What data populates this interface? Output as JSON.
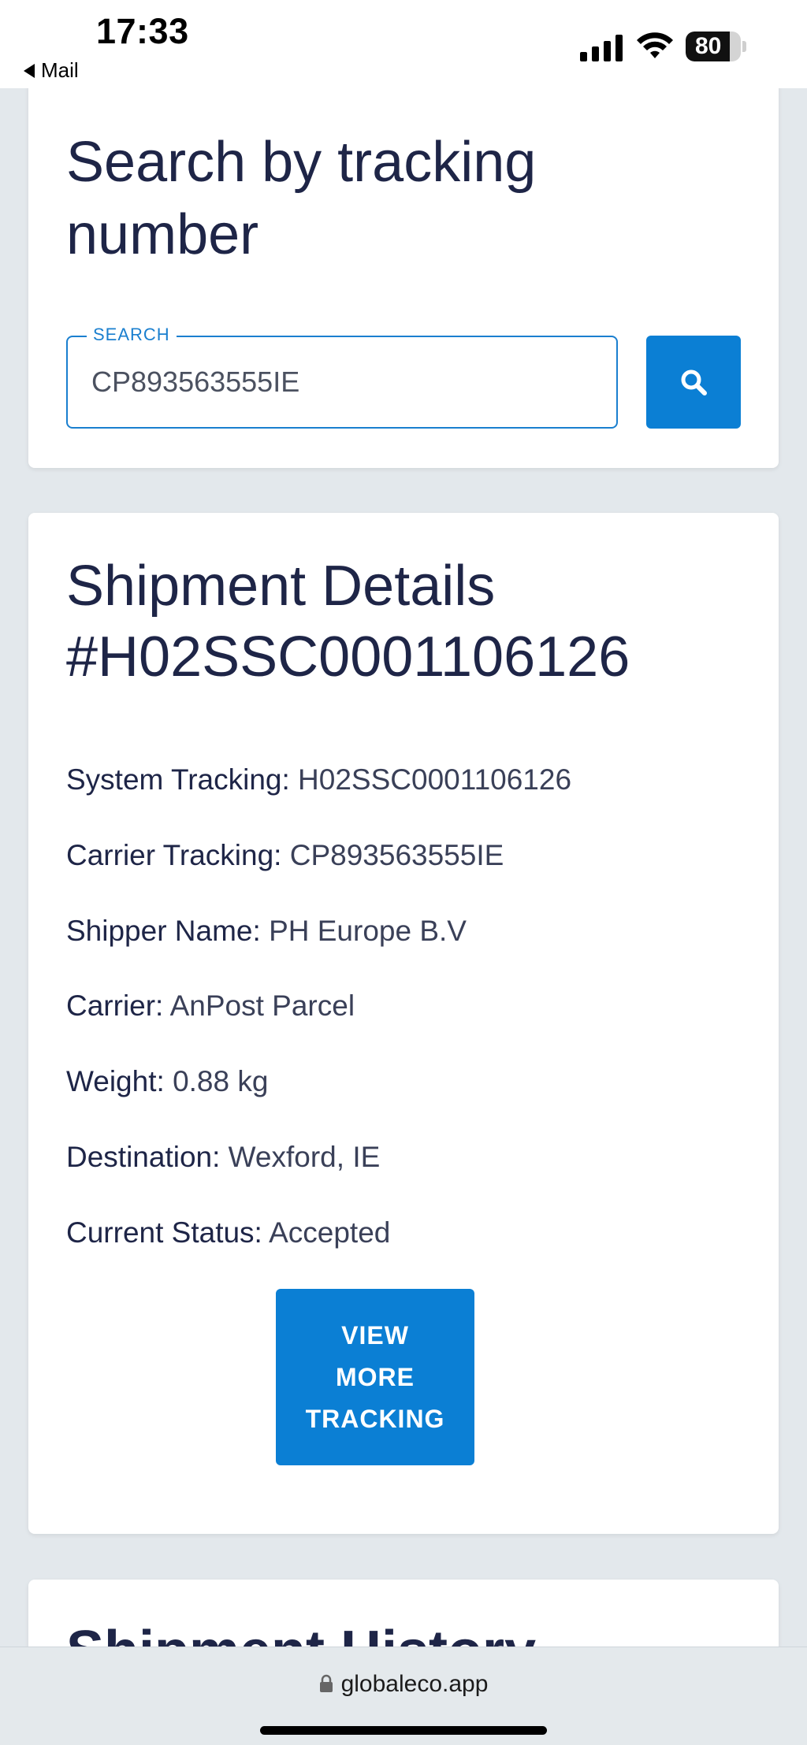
{
  "status_bar": {
    "time": "17:33",
    "back_app": "Mail",
    "battery": "80",
    "battery_level": 0.8
  },
  "search_card": {
    "title": "Search by tracking number",
    "field_label": "SEARCH",
    "field_value": "CP893563555IE",
    "button_icon": "search-icon"
  },
  "details_card": {
    "title": "Shipment Details #H02SSC0001106126",
    "rows": [
      {
        "label": "System Tracking:",
        "value": "H02SSC0001106126"
      },
      {
        "label": "Carrier Tracking:",
        "value": "CP893563555IE"
      },
      {
        "label": "Shipper Name:",
        "value": "PH Europe B.V"
      },
      {
        "label": "Carrier:",
        "value": "AnPost Parcel"
      },
      {
        "label": "Weight:",
        "value": "0.88 kg"
      },
      {
        "label": "Destination:",
        "value": "Wexford, IE"
      },
      {
        "label": "Current Status:",
        "value": "Accepted"
      }
    ],
    "more_button": {
      "line1": "VIEW",
      "line2": "MORE",
      "line3": "TRACKING"
    }
  },
  "history_card": {
    "title": "Shipment History"
  },
  "browser": {
    "url": "globaleco.app"
  },
  "colors": {
    "accent": "#0b7fd4",
    "heading": "#1e2547",
    "background": "#e3e8ec"
  }
}
